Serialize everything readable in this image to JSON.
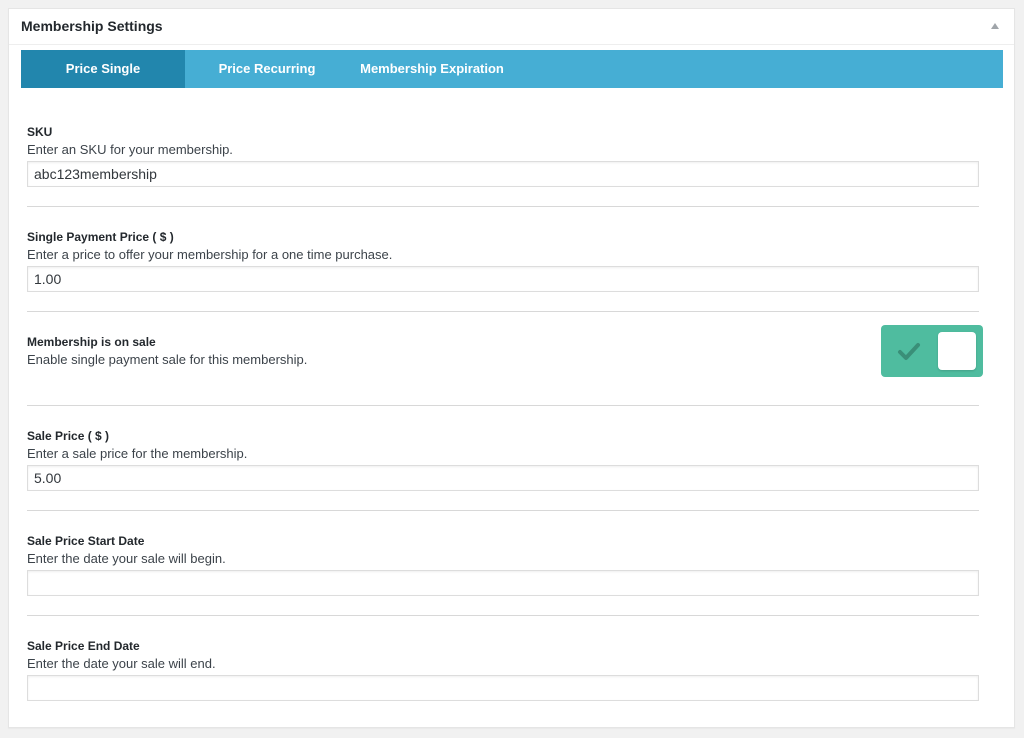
{
  "postbox": {
    "title": "Membership Settings",
    "toggle_icon": "triangle-up-icon"
  },
  "tabs": [
    {
      "label": "Price Single",
      "active": true
    },
    {
      "label": "Price Recurring",
      "active": false
    },
    {
      "label": "Membership Expiration",
      "active": false
    }
  ],
  "colors": {
    "tab_bar": "#46aed4",
    "tab_active": "#2286ad",
    "toggle_on": "#4fbc9f"
  },
  "fields": {
    "sku": {
      "label": "SKU",
      "description": "Enter an SKU for your membership.",
      "value": "abc123membership"
    },
    "single_price": {
      "label": "Single Payment Price ( $ )",
      "description": "Enter a price to offer your membership for a one time purchase.",
      "value": "1.00"
    },
    "on_sale": {
      "label": "Membership is on sale",
      "description": "Enable single payment sale for this membership.",
      "enabled": true,
      "icon": "checkmark-icon"
    },
    "sale_price": {
      "label": "Sale Price ( $ )",
      "description": "Enter a sale price for the membership.",
      "value": "5.00"
    },
    "sale_start": {
      "label": "Sale Price Start Date",
      "description": "Enter the date your sale will begin.",
      "value": ""
    },
    "sale_end": {
      "label": "Sale Price End Date",
      "description": "Enter the date your sale will end.",
      "value": ""
    }
  }
}
